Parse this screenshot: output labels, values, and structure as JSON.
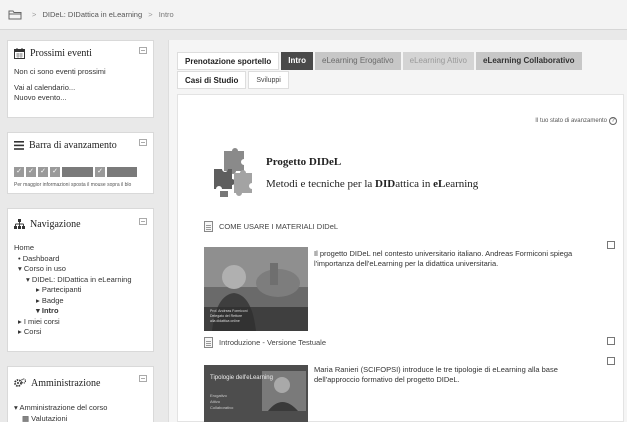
{
  "breadcrumb": {
    "items": [
      "DIDeL: DIDattica in eLearning",
      "Intro"
    ]
  },
  "blocks": {
    "eventi": {
      "title": "Prossimi eventi",
      "empty": "Non ci sono eventi prossimi",
      "link1": "Vai al calendario...",
      "link2": "Nuovo evento..."
    },
    "avanzamento": {
      "title": "Barra di avanzamento",
      "note": "Per maggior informazioni sposta il mouse sopra il blo",
      "completed_fraction": 0.75
    },
    "navigazione": {
      "title": "Navigazione",
      "items": [
        "Home",
        "Dashboard",
        "Corso in uso",
        "DIDeL: DIDattica in eLearning",
        "Partecipanti",
        "Badge",
        "Intro",
        "I miei corsi",
        "Corsi"
      ]
    },
    "amministrazione": {
      "title": "Amministrazione",
      "items": [
        "Amministrazione del corso",
        "Valutazioni"
      ]
    }
  },
  "tabs": {
    "row1": [
      "Prenotazione sportello",
      "Intro",
      "eLearning Erogativo",
      "eLearning Attivo",
      "eLearning Collaborativo"
    ],
    "row2": [
      "Casi di Studio",
      "Sviluppi"
    ]
  },
  "content": {
    "progress_link": "Il tuo stato di avanzamento",
    "hero_title": "Progetto DIDeL",
    "hero_sub_parts": [
      "Metodi e tecniche per la ",
      "DID",
      "attica in ",
      "eL",
      "earning"
    ],
    "resource1": "COME USARE I MATERIALI DIDeL",
    "desc1": "Il progetto DIDeL nel contesto universitario italiano. Andreas Formiconi spiega l'importanza dell'eLearning per la didattica universitaria.",
    "thumb1_caption": "Prof. Andreas Formiconi\nDelegato del Rettore\nalla didattica online",
    "resource2": "Introduzione - Versione Testuale",
    "desc2": "Maria Ranieri (SCIFOPSI) introduce le tre tipologie di eLearning alla base dell'approccio formativo del progetto DIDeL.",
    "thumb2_title": "Tipologie dell'eLearning",
    "thumb2_lines": [
      "Erogativo",
      "Attivo",
      "Collaborativo"
    ]
  },
  "colors": {
    "active_tab": "#4a4a4a",
    "grey_tab": "#c7c7c7"
  }
}
